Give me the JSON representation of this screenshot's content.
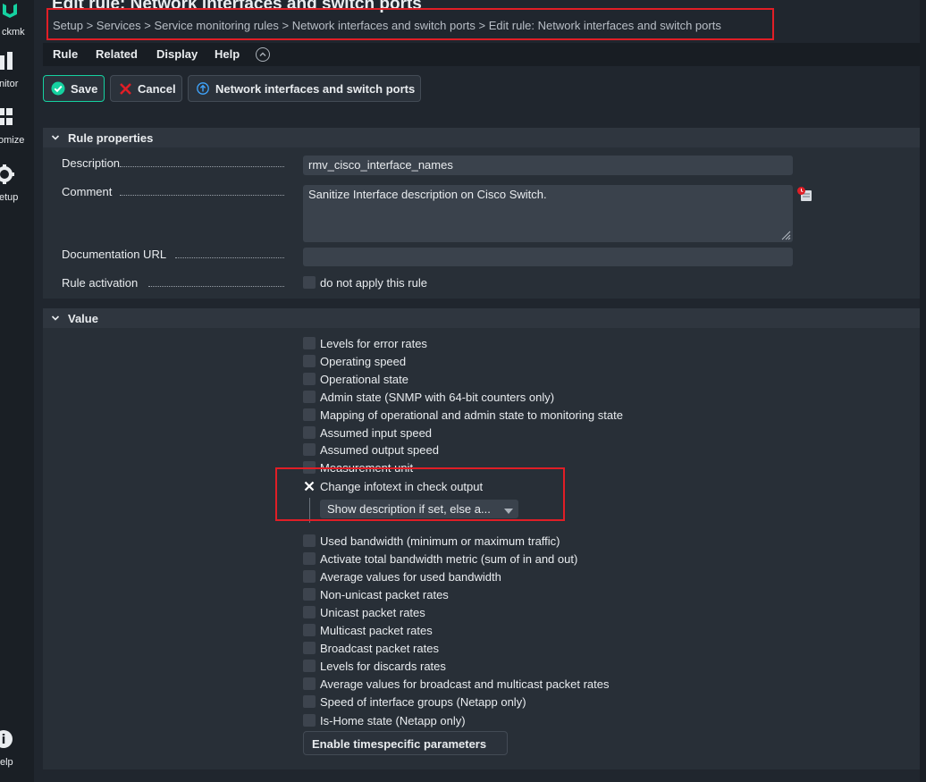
{
  "window": {
    "title": "Edit rule: Network interfaces and switch ports",
    "breadcrumb": "Setup > Services > Service monitoring rules > Network interfaces and switch ports > Edit rule: Network interfaces and switch ports"
  },
  "sidebar": {
    "brand": "ckmk",
    "items": [
      {
        "label": "nitor",
        "icon": "bar-chart-icon"
      },
      {
        "label": "omize",
        "icon": "grid-icon"
      },
      {
        "label": "etup",
        "icon": "gear-icon"
      },
      {
        "label": "elp",
        "icon": "help-icon"
      }
    ]
  },
  "menu": {
    "items": [
      "Rule",
      "Related",
      "Display",
      "Help"
    ]
  },
  "toolbar": {
    "save_label": "Save",
    "cancel_label": "Cancel",
    "parent_label": "Network interfaces and switch ports"
  },
  "rule_properties": {
    "title": "Rule properties",
    "description_label": "Description",
    "description_value": "rmv_cisco_interface_names",
    "comment_label": "Comment",
    "comment_value": "Sanitize Interface description on Cisco Switch.",
    "doc_url_label": "Documentation URL",
    "doc_url_value": "",
    "activation_label": "Rule activation",
    "activation_option": "do not apply this rule"
  },
  "value": {
    "title": "Value",
    "options_before": [
      "Levels for error rates",
      "Operating speed",
      "Operational state",
      "Admin state (SNMP with 64-bit counters only)",
      "Mapping of operational and admin state to monitoring state",
      "Assumed input speed",
      "Assumed output speed",
      "Measurement unit"
    ],
    "checked_option": "Change infotext in check output",
    "infotext_select": "Show description if set, else a...",
    "options_after": [
      "Used bandwidth (minimum or maximum traffic)",
      "Activate total bandwidth metric (sum of in and out)",
      "Average values for used bandwidth",
      "Non-unicast packet rates",
      "Unicast packet rates",
      "Multicast packet rates",
      "Broadcast packet rates",
      "Levels for discards rates",
      "Average values for broadcast and multicast packet rates",
      "Speed of interface groups (Netapp only)",
      "Is-Home state (Netapp only)"
    ],
    "timespecific_button": "Enable timespecific parameters"
  },
  "colors": {
    "accent": "#15d1a0",
    "highlight": "#e01e26",
    "background": "#20262e"
  }
}
